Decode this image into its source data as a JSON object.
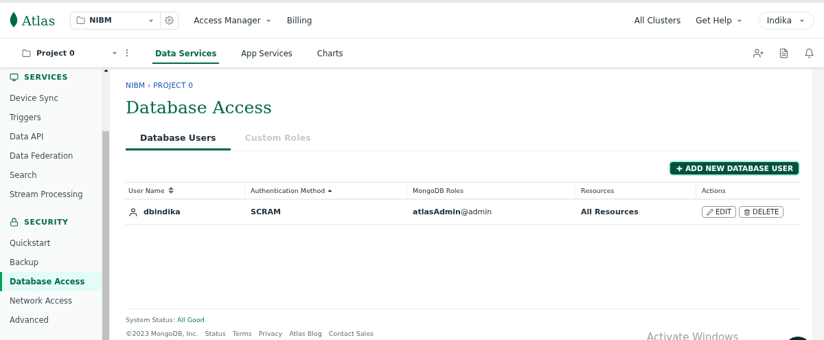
{
  "topbar": {
    "logo": "Atlas",
    "org": "NIBM",
    "nav": [
      {
        "label": "Access Manager",
        "dropdown": true
      },
      {
        "label": "Billing",
        "dropdown": false
      }
    ],
    "right": [
      {
        "label": "All Clusters",
        "dropdown": false
      },
      {
        "label": "Get Help",
        "dropdown": true
      }
    ],
    "user": "Indika"
  },
  "projectbar": {
    "project": "Project 0",
    "tabs": [
      {
        "label": "Data Services",
        "selected": true
      },
      {
        "label": "App Services",
        "selected": false
      },
      {
        "label": "Charts",
        "selected": false
      }
    ]
  },
  "sidebar": {
    "sections": [
      {
        "title": "SERVICES",
        "kind": "services",
        "items": [
          {
            "label": "Device Sync",
            "selected": false
          },
          {
            "label": "Triggers",
            "selected": false
          },
          {
            "label": "Data API",
            "selected": false
          },
          {
            "label": "Data Federation",
            "selected": false
          },
          {
            "label": "Search",
            "selected": false
          },
          {
            "label": "Stream Processing",
            "selected": false
          }
        ]
      },
      {
        "title": "SECURITY",
        "kind": "security",
        "items": [
          {
            "label": "Quickstart",
            "selected": false
          },
          {
            "label": "Backup",
            "selected": false
          },
          {
            "label": "Database Access",
            "selected": true
          },
          {
            "label": "Network Access",
            "selected": false
          },
          {
            "label": "Advanced",
            "selected": false
          }
        ]
      }
    ]
  },
  "breadcrumb": "NIBM › PROJECT 0",
  "title": "Database Access",
  "tabs": [
    {
      "label": "Database Users",
      "selected": true
    },
    {
      "label": "Custom Roles",
      "selected": false
    }
  ],
  "add_button": "ADD NEW DATABASE USER",
  "table": {
    "columns": [
      {
        "label": "User Name",
        "sortable": true,
        "sorted": false
      },
      {
        "label": "Authentication Method",
        "sortable": true,
        "sorted": true
      },
      {
        "label": "MongoDB Roles",
        "sortable": false
      },
      {
        "label": "Resources",
        "sortable": false
      },
      {
        "label": "Actions",
        "sortable": false
      }
    ],
    "rows": [
      {
        "user": "dbindika",
        "auth": "SCRAM",
        "roles": "**atlasAdmin**@admin",
        "resources": "All Resources",
        "actions": [
          {
            "kind": "edit",
            "label": "EDIT"
          },
          {
            "kind": "delete",
            "label": "DELETE"
          }
        ]
      }
    ]
  },
  "footer": {
    "status_label": "System Status:",
    "status_value": "All Good",
    "copyright": "©2023 MongoDB, Inc.",
    "links": [
      "Status",
      "Terms",
      "Privacy",
      "Atlas Blog",
      "Contact Sales"
    ]
  },
  "os_overlay": "Activate Windows"
}
